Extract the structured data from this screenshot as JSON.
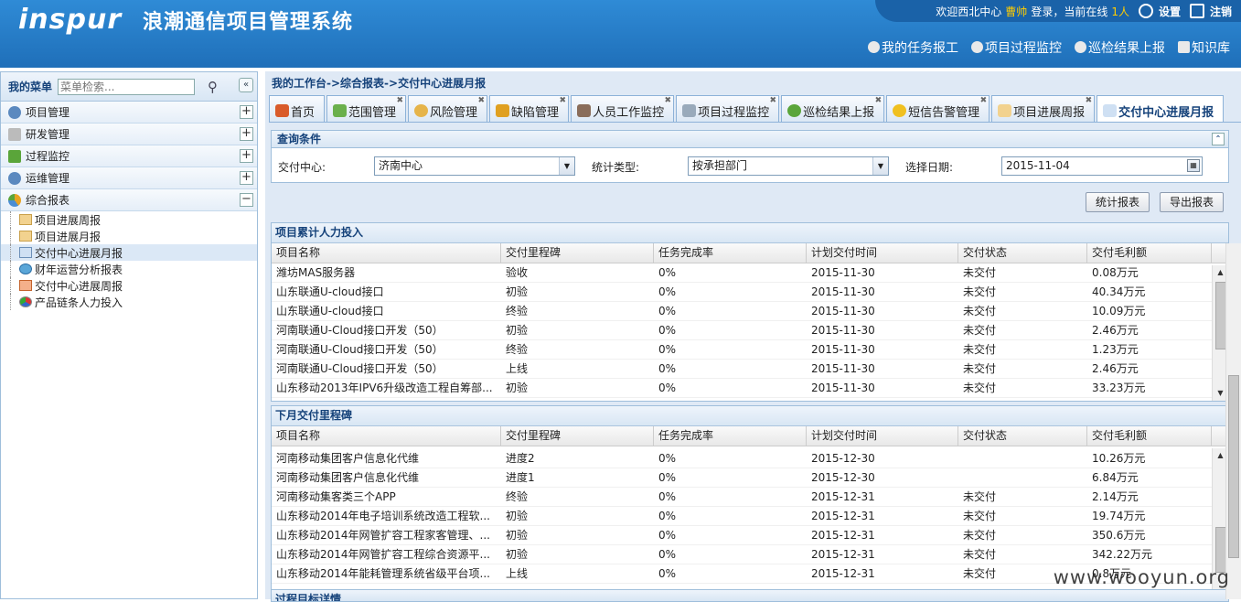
{
  "header": {
    "logo": "inspur",
    "system_name": "浪潮通信项目管理系统",
    "welcome": "欢迎西北中心",
    "user": "曹帅",
    "login_text": "登录，当前在线",
    "online_count": "1人",
    "settings": "设置",
    "logout": "注销",
    "links": [
      "我的任务报工",
      "项目过程监控",
      "巡检结果上报",
      "知识库"
    ]
  },
  "sidebar": {
    "title": "我的菜单",
    "search_placeholder": "菜单检索...",
    "groups": [
      {
        "label": "项目管理"
      },
      {
        "label": "研发管理"
      },
      {
        "label": "过程监控"
      },
      {
        "label": "运维管理"
      },
      {
        "label": "综合报表"
      }
    ],
    "subitems": [
      "项目进展周报",
      "项目进展月报",
      "交付中心进展月报",
      "财年运营分析报表",
      "交付中心进展周报",
      "产品链条人力投入"
    ]
  },
  "main": {
    "breadcrumb": "我的工作台->综合报表->交付中心进展月报",
    "tabs": [
      "首页",
      "范围管理",
      "风险管理",
      "缺陷管理",
      "人员工作监控",
      "项目过程监控",
      "巡检结果上报",
      "短信告警管理",
      "项目进展周报",
      "交付中心进展月报"
    ],
    "query": {
      "title": "查询条件",
      "center_label": "交付中心:",
      "center_value": "济南中心",
      "type_label": "统计类型:",
      "type_value": "按承担部门",
      "date_label": "选择日期:",
      "date_value": "2015-11-04",
      "btn_stat": "统计报表",
      "btn_export": "导出报表"
    },
    "columns": [
      "项目名称",
      "交付里程碑",
      "任务完成率",
      "计划交付时间",
      "交付状态",
      "交付毛利额"
    ],
    "panel1": {
      "title": "项目累计人力投入",
      "rows": [
        [
          "潍坊MAS服务器",
          "验收",
          "0%",
          "2015-11-30",
          "未交付",
          "0.08万元"
        ],
        [
          "山东联通U-cloud接口",
          "初验",
          "0%",
          "2015-11-30",
          "未交付",
          "40.34万元"
        ],
        [
          "山东联通U-cloud接口",
          "终验",
          "0%",
          "2015-11-30",
          "未交付",
          "10.09万元"
        ],
        [
          "河南联通U-Cloud接口开发（50）",
          "初验",
          "0%",
          "2015-11-30",
          "未交付",
          "2.46万元"
        ],
        [
          "河南联通U-Cloud接口开发（50）",
          "终验",
          "0%",
          "2015-11-30",
          "未交付",
          "1.23万元"
        ],
        [
          "河南联通U-Cloud接口开发（50）",
          "上线",
          "0%",
          "2015-11-30",
          "未交付",
          "2.46万元"
        ],
        [
          "山东移动2013年IPV6升级改造工程自筹部...",
          "初验",
          "0%",
          "2015-11-30",
          "未交付",
          "33.23万元"
        ]
      ]
    },
    "panel2": {
      "title": "下月交付里程碑",
      "rows": [
        [
          "河南移动集团客户信息化代维",
          "进度2",
          "0%",
          "2015-12-30",
          "",
          "10.26万元"
        ],
        [
          "河南移动集团客户信息化代维",
          "进度1",
          "0%",
          "2015-12-30",
          "",
          "6.84万元"
        ],
        [
          "河南移动集客类三个APP",
          "终验",
          "0%",
          "2015-12-31",
          "未交付",
          "2.14万元"
        ],
        [
          "山东移动2014年电子培训系统改造工程软...",
          "初验",
          "0%",
          "2015-12-31",
          "未交付",
          "19.74万元"
        ],
        [
          "山东移动2014年网管扩容工程家客管理、...",
          "初验",
          "0%",
          "2015-12-31",
          "未交付",
          "350.6万元"
        ],
        [
          "山东移动2014年网管扩容工程综合资源平...",
          "初验",
          "0%",
          "2015-12-31",
          "未交付",
          "342.22万元"
        ],
        [
          "山东移动2014年能耗管理系统省级平台项...",
          "上线",
          "0%",
          "2015-12-31",
          "未交付",
          "0.8万元"
        ]
      ]
    },
    "panel3_title": "过程目标详情"
  },
  "watermark": "www.wooyun.org"
}
